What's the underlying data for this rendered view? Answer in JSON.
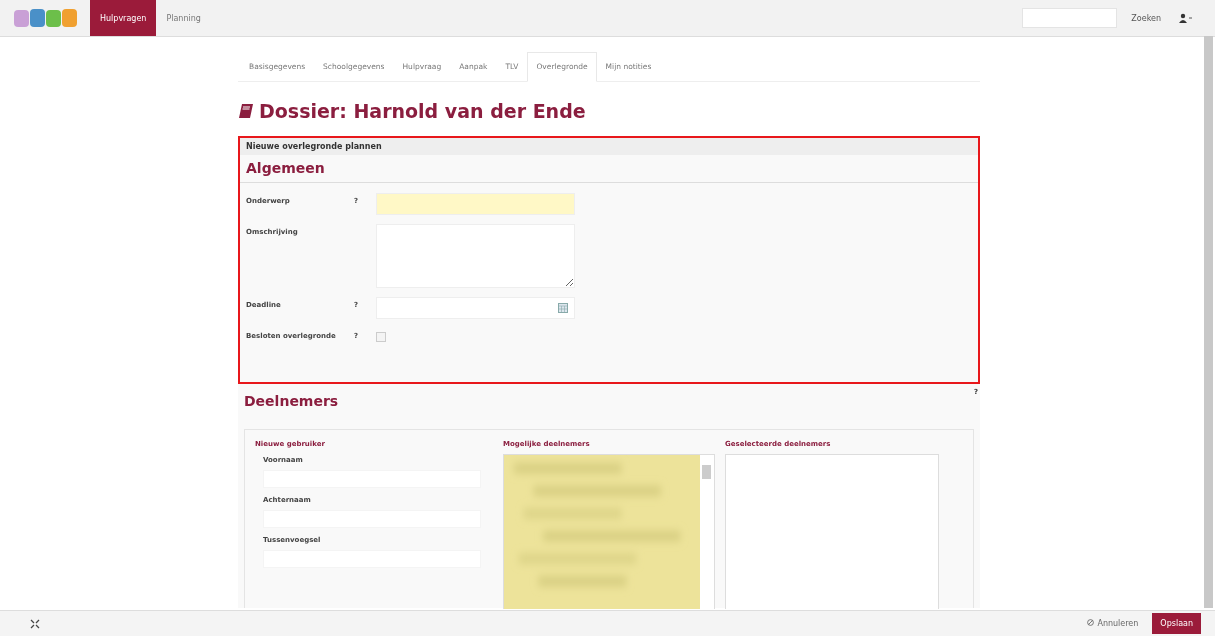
{
  "navbar": {
    "items": [
      {
        "label": "Hulpvragen",
        "selected": true
      },
      {
        "label": "Planning",
        "selected": false
      }
    ],
    "search_button": "Zoeken"
  },
  "tabs": [
    {
      "label": "Basisgegevens",
      "selected": false
    },
    {
      "label": "Schoolgegevens",
      "selected": false
    },
    {
      "label": "Hulpvraag",
      "selected": false
    },
    {
      "label": "Aanpak",
      "selected": false
    },
    {
      "label": "TLV",
      "selected": false
    },
    {
      "label": "Overlegronde",
      "selected": true
    },
    {
      "label": "Mijn notities",
      "selected": false
    }
  ],
  "title": "Dossier: Harnold van der Ende",
  "panel": {
    "heading": "Nieuwe overlegronde plannen",
    "section": "Algemeen",
    "fields": [
      {
        "kind": "text",
        "label": "Onderwerp",
        "help": "?",
        "required": true
      },
      {
        "kind": "textarea",
        "label": "Omschrijving",
        "required": false
      },
      {
        "kind": "date",
        "label": "Deadline",
        "help": "?",
        "required": false
      },
      {
        "kind": "checkbox",
        "label": "Besloten overlegronde",
        "help": "?",
        "checked": false
      }
    ]
  },
  "participants": {
    "title": "Deelnemers",
    "help": "?",
    "new_user": {
      "title": "Nieuwe gebruiker",
      "fields": [
        "Voornaam",
        "Achternaam",
        "Tussenvoegsel"
      ]
    },
    "possible_title": "Mogelijke deelnemers",
    "selected_title": "Geselecteerde deelnemers"
  },
  "footer": {
    "cancel": "Annuleren",
    "save": "Opslaan"
  }
}
